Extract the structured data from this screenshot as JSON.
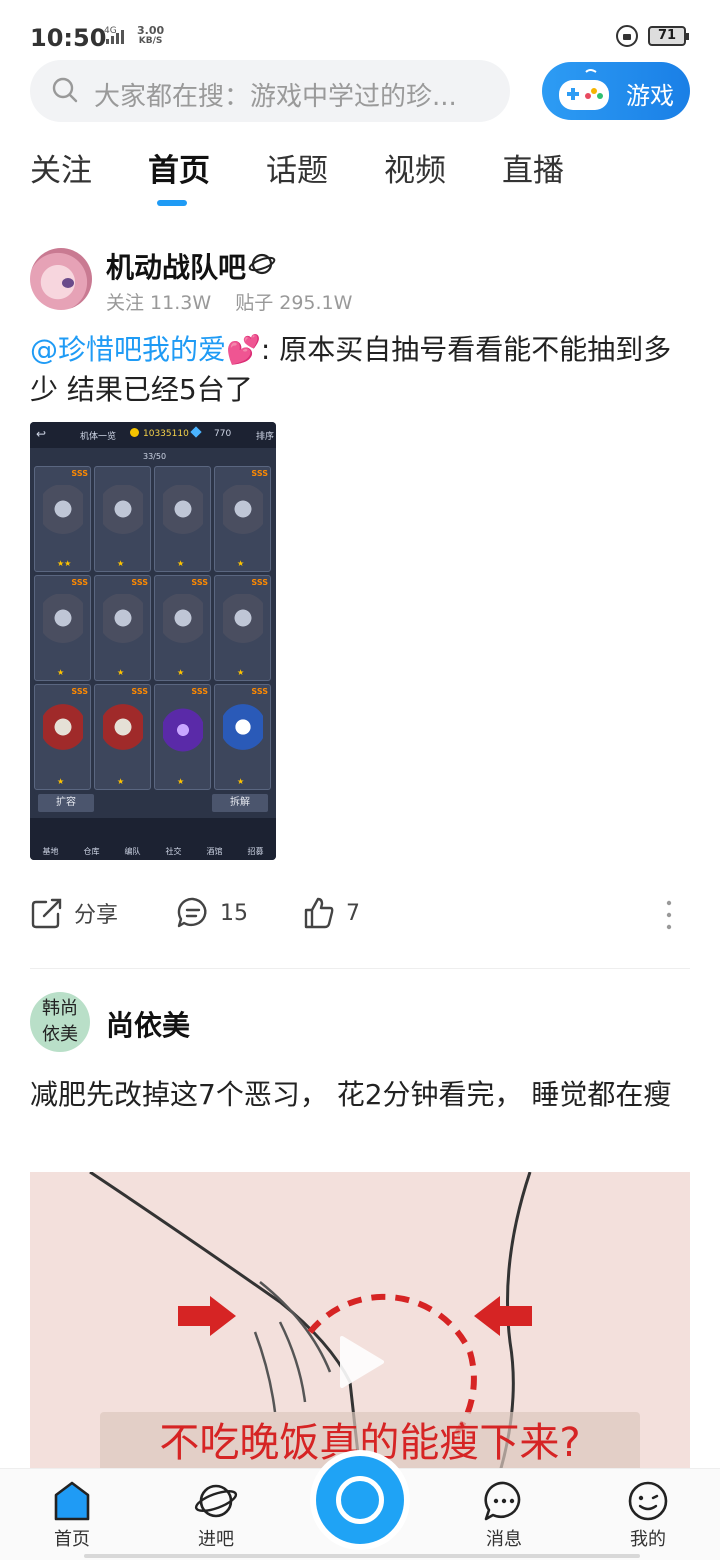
{
  "status_bar": {
    "time": "10:50",
    "network": "4G",
    "speed_value": "3.00",
    "speed_unit": "KB/S",
    "battery": "71"
  },
  "search": {
    "placeholder": "大家都在搜：游戏中学过的珍...",
    "game_button_label": "游戏"
  },
  "tabs": [
    {
      "label": "关注",
      "active": false
    },
    {
      "label": "首页",
      "active": true
    },
    {
      "label": "话题",
      "active": false
    },
    {
      "label": "视频",
      "active": false
    },
    {
      "label": "直播",
      "active": false
    }
  ],
  "post1": {
    "forum_name": "机动战队吧",
    "followers": "关注 11.3W",
    "posts": "贴子 295.1W",
    "mention": "@珍惜吧我的爱",
    "heart": "💕",
    "text": ": 原本买自抽号看看能不能抽到多少 结果已经5台了",
    "image": {
      "header_title": "机体一览",
      "gold": "10335110",
      "gems": "770",
      "sort_label": "排序",
      "count": "33/50",
      "expand_label": "扩容",
      "dismantle_label": "拆解",
      "nav": [
        "基地",
        "仓库",
        "编队",
        "社交",
        "酒馆",
        "招募"
      ]
    },
    "share_label": "分享",
    "comment_count": "15",
    "like_count": "7"
  },
  "post2": {
    "avatar_text_top": "韩尚",
    "avatar_text_bottom": "依美",
    "author": "尚依美",
    "text": "减肥先改掉这7个恶习， 花2分钟看完， 睡觉都在瘦",
    "video_caption": "不吃晚饭真的能瘦下来?"
  },
  "bottom_nav": {
    "home": "首页",
    "forums": "进吧",
    "messages": "消息",
    "mine": "我的"
  },
  "colors": {
    "accent": "#1f9bf5",
    "mention": "#1f9bf5",
    "caption_red": "#d62424"
  }
}
